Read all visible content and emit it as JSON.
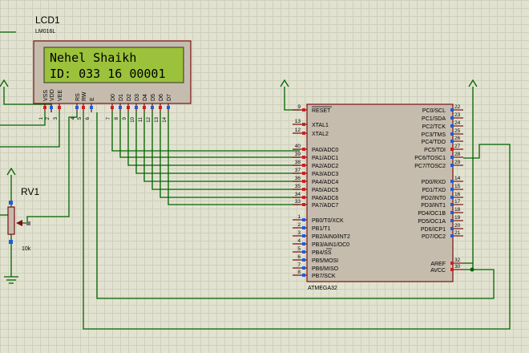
{
  "lcd": {
    "ref": "LCD1",
    "model": "LM016L",
    "line1": "Nehel Shaikh",
    "line2": "ID: 033 16 00001",
    "pins": [
      {
        "name": "VSS",
        "num": "1"
      },
      {
        "name": "VDD",
        "num": "2"
      },
      {
        "name": "VEE",
        "num": "3"
      },
      {
        "name": "RS",
        "num": "4"
      },
      {
        "name": "RW",
        "num": "5"
      },
      {
        "name": "E",
        "num": "6"
      },
      {
        "name": "D0",
        "num": "7"
      },
      {
        "name": "D1",
        "num": "8"
      },
      {
        "name": "D2",
        "num": "9"
      },
      {
        "name": "D3",
        "num": "10"
      },
      {
        "name": "D4",
        "num": "11"
      },
      {
        "name": "D5",
        "num": "12"
      },
      {
        "name": "D6",
        "num": "13"
      },
      {
        "name": "D7",
        "num": "14"
      }
    ]
  },
  "mcu": {
    "name": "ATMEGA32",
    "left_pins": [
      {
        "num": "9",
        "label": "RESET"
      },
      {
        "num": "13",
        "label": "XTAL1"
      },
      {
        "num": "12",
        "label": "XTAL2"
      },
      {
        "num": "40",
        "label": "PA0/ADC0"
      },
      {
        "num": "39",
        "label": "PA1/ADC1"
      },
      {
        "num": "38",
        "label": "PA2/ADC2"
      },
      {
        "num": "37",
        "label": "PA3/ADC3"
      },
      {
        "num": "36",
        "label": "PA4/ADC4"
      },
      {
        "num": "35",
        "label": "PA5/ADC5"
      },
      {
        "num": "34",
        "label": "PA6/ADC6"
      },
      {
        "num": "33",
        "label": "PA7/ADC7"
      },
      {
        "num": "1",
        "label": "PB0/T0/XCK"
      },
      {
        "num": "2",
        "label": "PB1/T1"
      },
      {
        "num": "3",
        "label": "PB2/AIN0/INT2"
      },
      {
        "num": "4",
        "label": "PB3/AIN1/OC0"
      },
      {
        "num": "5",
        "label": "PB4/SS"
      },
      {
        "num": "6",
        "label": "PB5/MOSI"
      },
      {
        "num": "7",
        "label": "PB6/MISO"
      },
      {
        "num": "8",
        "label": "PB7/SCK"
      }
    ],
    "right_pins": [
      {
        "num": "22",
        "label": "PC0/SCL"
      },
      {
        "num": "23",
        "label": "PC1/SDA"
      },
      {
        "num": "24",
        "label": "PC2/TCK"
      },
      {
        "num": "25",
        "label": "PC3/TMS"
      },
      {
        "num": "26",
        "label": "PC4/TDO"
      },
      {
        "num": "27",
        "label": "PC5/TDI"
      },
      {
        "num": "28",
        "label": "PC6/TOSC1"
      },
      {
        "num": "29",
        "label": "PC7/TOSC2"
      },
      {
        "num": "14",
        "label": "PD0/RXD"
      },
      {
        "num": "15",
        "label": "PD1/TXD"
      },
      {
        "num": "16",
        "label": "PD2/INT0"
      },
      {
        "num": "17",
        "label": "PD3/INT1"
      },
      {
        "num": "18",
        "label": "PD4/OC1B"
      },
      {
        "num": "19",
        "label": "PD5/OC1A"
      },
      {
        "num": "20",
        "label": "PD6/ICP1"
      },
      {
        "num": "21",
        "label": "PD7/OC2"
      },
      {
        "num": "32",
        "label": "AREF"
      },
      {
        "num": "30",
        "label": "AVCC"
      }
    ]
  },
  "pot": {
    "ref": "RV1",
    "value": "10k"
  },
  "colors": {
    "wire": "#006400",
    "body": "#c6bcae",
    "pin": "#8b0000",
    "lcd_screen": "#9bc23a",
    "lcd_text": "#1c2a05"
  }
}
